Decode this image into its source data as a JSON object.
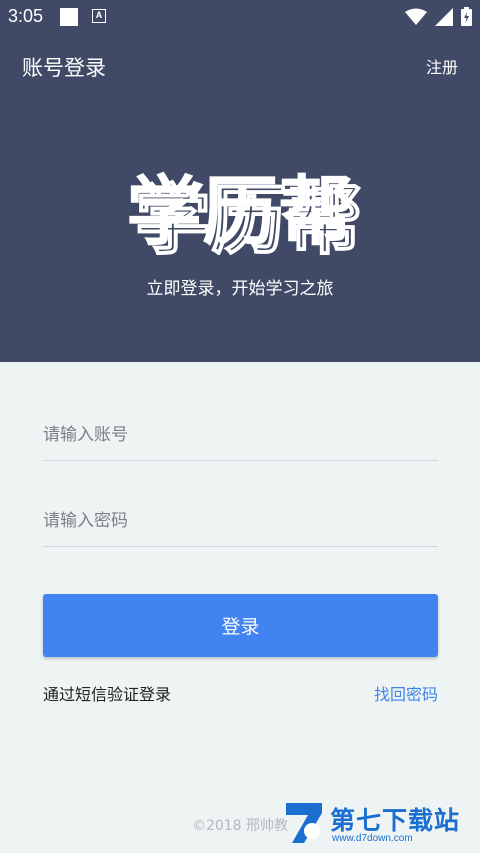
{
  "status_bar": {
    "time": "3:05",
    "a_badge": "A"
  },
  "app_bar": {
    "title": "账号登录",
    "register": "注册"
  },
  "logo": {
    "text": "学历帮"
  },
  "tagline": "立即登录，开始学习之旅",
  "form": {
    "account_placeholder": "请输入账号",
    "password_placeholder": "请输入密码",
    "login_button": "登录",
    "sms_login": "通过短信验证登录",
    "forgot_password": "找回密码"
  },
  "footer": {
    "copyright": "©2018 邢帅教"
  },
  "watermark": {
    "brand": "第七下载站",
    "url": "www.d7down.com"
  },
  "colors": {
    "header": "#404a66",
    "primary": "#4183f0",
    "link": "#3f86e8",
    "background": "#eef3f4"
  }
}
